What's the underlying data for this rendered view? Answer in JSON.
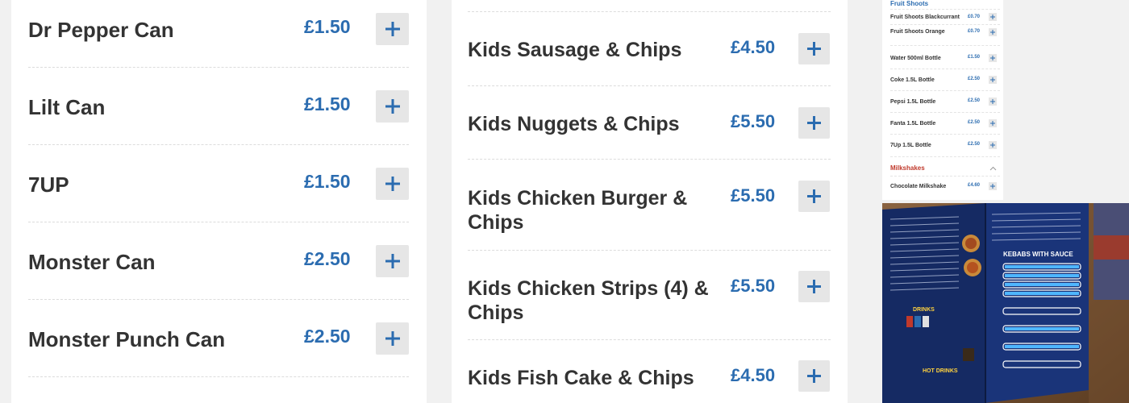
{
  "colors": {
    "price": "#2b6cb0",
    "name": "#333333",
    "add_bg": "#e6e6e6",
    "section_blue": "#2b6cb0",
    "section_red": "#c0392b"
  },
  "drinks_panel": {
    "items": [
      {
        "name": "Dr Pepper Can",
        "price": "£1.50"
      },
      {
        "name": "Lilt Can",
        "price": "£1.50"
      },
      {
        "name": "7UP",
        "price": "£1.50"
      },
      {
        "name": "Monster Can",
        "price": "£2.50"
      },
      {
        "name": "Monster Punch Can",
        "price": "£2.50"
      }
    ]
  },
  "kids_panel": {
    "items": [
      {
        "name": "Kids Sausage & Chips",
        "price": "£4.50"
      },
      {
        "name": "Kids Nuggets & Chips",
        "price": "£5.50"
      },
      {
        "name": "Kids Chicken Burger & Chips",
        "price": "£5.50"
      },
      {
        "name": "Kids Chicken Strips (4) & Chips",
        "price": "£5.50"
      },
      {
        "name": "Kids Fish Cake & Chips",
        "price": "£4.50"
      }
    ]
  },
  "mini_menu": {
    "fruit_shoots_title": "Fruit Shoots",
    "fruit_shoots": [
      {
        "name": "Fruit Shoots Blackcurrant",
        "price": "£0.70"
      },
      {
        "name": "Fruit Shoots Orange",
        "price": "£0.70"
      }
    ],
    "bottles": [
      {
        "name": "Water 500ml Bottle",
        "price": "£1.50"
      },
      {
        "name": "Coke 1.5L Bottle",
        "price": "£2.50"
      },
      {
        "name": "Pepsi 1.5L Bottle",
        "price": "£2.50"
      },
      {
        "name": "Fanta 1.5L Bottle",
        "price": "£2.50"
      },
      {
        "name": "7Up 1.5L Bottle",
        "price": "£2.50"
      }
    ],
    "milkshakes_title": "Milkshakes",
    "milkshakes": [
      {
        "name": "Chocolate Milkshake",
        "price": "£4.60"
      }
    ]
  },
  "photo": {
    "icon": "menu-photo",
    "headings": [
      "DRINKS",
      "HOT DRINKS",
      "KEBABS WITH SAUCE"
    ],
    "deals": [
      "ANY 12\" PIZZA",
      "ANY 12\" PIZZA",
      "ANY 16\" PIZZA",
      "FAMILY DEAL",
      "NEW FOREST BISTRO SPECIAL",
      "CHICKEN PLATTER",
      "LAMB PLATTER",
      "TO SHARE SPECIAL"
    ]
  }
}
